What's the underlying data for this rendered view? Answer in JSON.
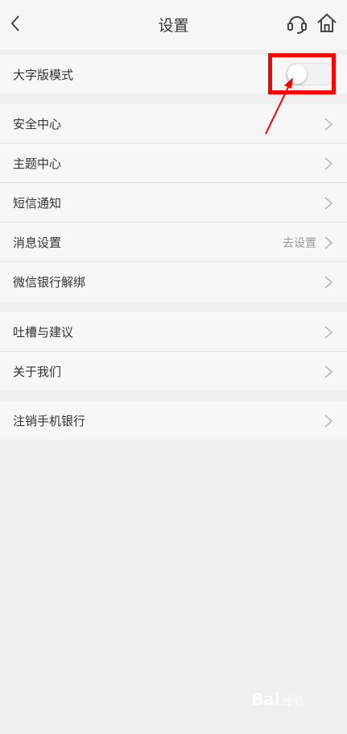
{
  "header": {
    "title": "设置"
  },
  "large_mode": {
    "label": "大字版模式",
    "enabled": false
  },
  "group2": [
    {
      "label": "安全中心"
    },
    {
      "label": "主题中心"
    },
    {
      "label": "短信通知"
    },
    {
      "label": "消息设置",
      "value": "去设置"
    },
    {
      "label": "微信银行解绑"
    }
  ],
  "group3": [
    {
      "label": "吐槽与建议"
    },
    {
      "label": "关于我们"
    }
  ],
  "group4": [
    {
      "label": "注销手机银行"
    }
  ],
  "watermark": {
    "text": "Bai",
    "sub": "经验"
  },
  "colors": {
    "highlight": "#ff0000",
    "background": "#efefef"
  }
}
